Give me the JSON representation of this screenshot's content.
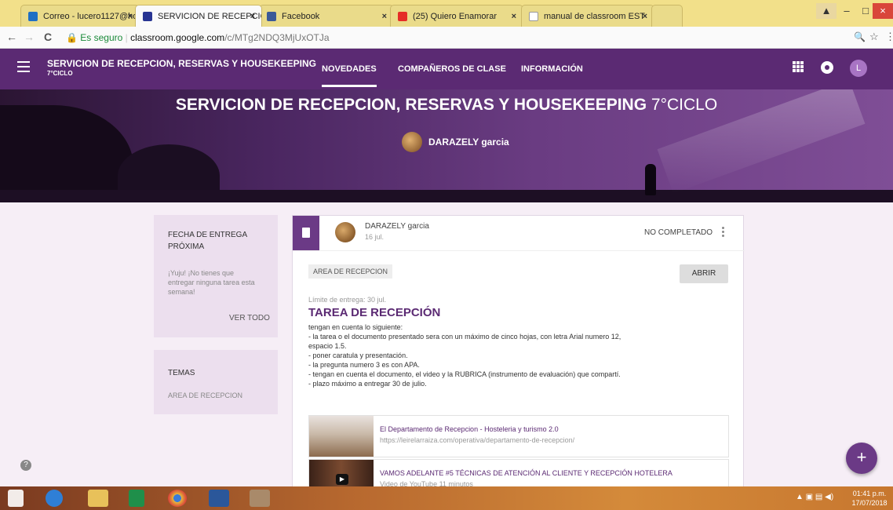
{
  "browser": {
    "tabs": [
      {
        "label": "Correo - lucero1127@ho"
      },
      {
        "label": "SERVICION DE RECEPCIO"
      },
      {
        "label": "Facebook"
      },
      {
        "label": "(25) Quiero Enamorar"
      },
      {
        "label": "manual de classroom EST"
      }
    ],
    "nav": {
      "back": "←",
      "forward": "→",
      "reload": "C"
    },
    "address": {
      "security_label": "Es seguro",
      "host": "classroom.google.com",
      "path": "/c/MTg2NDQ3MjUxOTJa"
    },
    "window_controls": {
      "minimize": "–",
      "maximize": "□",
      "close": "×"
    },
    "zoom_icon": "🔍",
    "star_icon": "☆"
  },
  "header": {
    "class_title": "SERVICION DE RECEPCION, RESERVAS Y HOUSEKEEPING",
    "class_subtitle": "7°CICLO",
    "tabs": [
      "NOVEDADES",
      "COMPAÑEROS DE CLASE",
      "INFORMACIÓN"
    ],
    "avatar_letter": "L",
    "brand_color": "#5b2a73"
  },
  "banner": {
    "title_bold": "SERVICION DE RECEPCION, RESERVAS Y HOUSEKEEPING",
    "title_light": "7°CICLO",
    "teacher": "DARAZELY garcia"
  },
  "sidebar": {
    "upcoming": {
      "title": "FECHA DE ENTREGA PRÓXIMA",
      "text": "¡Yuju! ¡No tienes que entregar ninguna tarea esta semana!",
      "link": "VER TODO"
    },
    "topics": {
      "title": "TEMAS",
      "item": "AREA DE RECEPCION"
    }
  },
  "post": {
    "author": "DARAZELY garcia",
    "date": "16 jul.",
    "status": "NO COMPLETADO",
    "topic": "AREA DE RECEPCION",
    "open_label": "ABRIR",
    "due": "Límite de entrega: 30 jul.",
    "title": "TAREA DE RECEPCIÓN",
    "lines": [
      "tengan en cuenta lo siguiente:",
      "- la tarea o el documento presentado sera con un máximo de cinco hojas, con letra Arial numero 12,",
      "espacio 1.5.",
      "- poner caratula y presentación.",
      "- la pregunta numero 3 es con APA.",
      "- tengan en cuenta el documento, el video y la RUBRICA (instrumento de evaluación) que compartí.",
      "- plazo máximo a entregar 30 de julio."
    ],
    "attachments": [
      {
        "title": "El Departamento de Recepcion - Hosteleria y turismo 2.0",
        "subtitle": "https://leirelarraiza.com/operativa/departamento-de-recepcion/"
      },
      {
        "title": "VAMOS ADELANTE #5 TÉCNICAS DE ATENCIÓN AL CLIENTE Y RECEPCIÓN HOTELERA",
        "subtitle": "Video de YouTube   11 minutos"
      }
    ]
  },
  "fab_label": "+",
  "help_label": "?",
  "taskbar": {
    "clock_time": "01:41 p.m.",
    "clock_date": "17/07/2018"
  }
}
